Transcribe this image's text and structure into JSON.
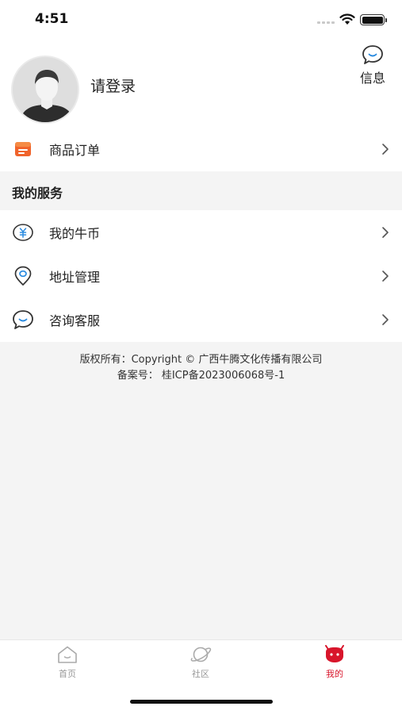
{
  "status_bar": {
    "time": "4:51"
  },
  "profile": {
    "login_text": "请登录",
    "message_label": "信息"
  },
  "orders": {
    "label": "商品订单"
  },
  "services": {
    "title": "我的服务",
    "items": [
      {
        "label": "我的牛币",
        "icon": "coin-icon"
      },
      {
        "label": "地址管理",
        "icon": "location-icon"
      },
      {
        "label": "咨询客服",
        "icon": "chat-icon"
      }
    ]
  },
  "footer": {
    "copyright": "版权所有：Copyright © 广西牛腾文化传播有限公司",
    "icp": "备案号：  桂ICP备2023006068号-1"
  },
  "tabbar": {
    "tabs": [
      {
        "label": "首页",
        "icon": "home-icon",
        "active": false
      },
      {
        "label": "社区",
        "icon": "planet-icon",
        "active": false
      },
      {
        "label": "我的",
        "icon": "mine-icon",
        "active": true
      }
    ],
    "active_color": "#d8152b"
  }
}
